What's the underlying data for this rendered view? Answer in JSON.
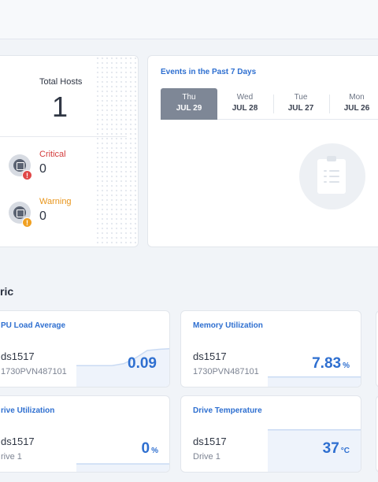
{
  "summary": {
    "total_hosts_label": "Total Hosts",
    "total_hosts_value": "1",
    "critical_label": "Critical",
    "critical_value": "0",
    "critical_badge": "!",
    "warning_label": "Warning",
    "warning_value": "0",
    "warning_badge": "!"
  },
  "events": {
    "title": "Events in the Past 7 Days",
    "days": [
      {
        "name": "Thu",
        "date": "JUL 29",
        "active": true
      },
      {
        "name": "Wed",
        "date": "JUL 28",
        "active": false
      },
      {
        "name": "Tue",
        "date": "JUL 27",
        "active": false
      },
      {
        "name": "Mon",
        "date": "JUL 26",
        "active": false
      }
    ],
    "empty_icon": "clipboard-icon"
  },
  "section": {
    "title": "ric"
  },
  "metrics": [
    {
      "title": "PU Load Average",
      "host": "ds1517",
      "sub": "1730PVN487101",
      "value": "0.09",
      "unit": "",
      "trend": [
        0.35,
        0.35,
        0.35,
        0.35,
        0.4,
        0.55,
        0.75,
        0.78,
        0.8
      ]
    },
    {
      "title": "Memory Utilization",
      "host": "ds1517",
      "sub": "1730PVN487101",
      "value": "7.83",
      "unit": "%",
      "trend": [
        0.05,
        0.05,
        0.05,
        0.05,
        0.05,
        0.05,
        0.05,
        0.05,
        0.05
      ]
    },
    {
      "title": "rive Utilization",
      "host": "ds1517",
      "sub": "rive 1",
      "value": "0",
      "unit": "%",
      "trend": [
        0.0,
        0.0,
        0.0,
        0.0,
        0.0,
        0.0,
        0.0,
        0.0,
        0.0
      ]
    },
    {
      "title": "Drive Temperature",
      "host": "ds1517",
      "sub": "Drive 1",
      "value": "37",
      "unit": "°C",
      "trend": [
        0.9,
        0.9,
        0.9,
        0.9,
        0.9,
        0.9,
        0.9,
        0.9,
        0.9
      ]
    }
  ],
  "colors": {
    "accent": "#2e6fd0",
    "critical": "#d43c3c",
    "warning": "#e8951b",
    "active_tab": "#7e8796"
  }
}
